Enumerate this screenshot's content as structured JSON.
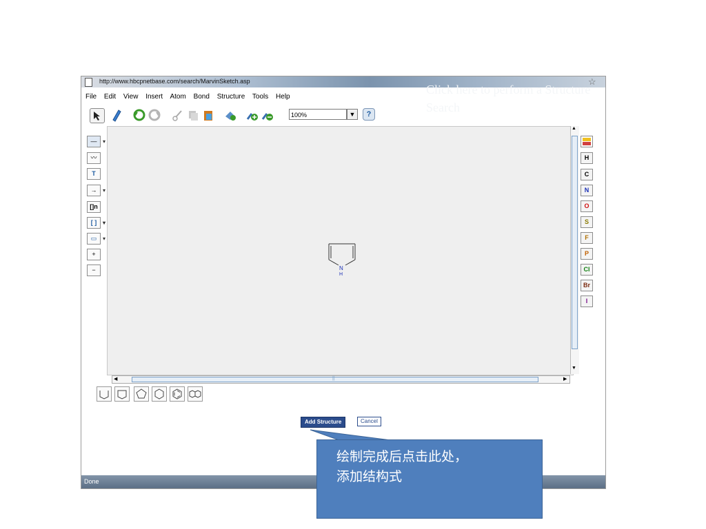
{
  "browser": {
    "url": "http://www.hbcpnetbase.com/search/MarvinSketch.asp",
    "status": "Done"
  },
  "overlay_title": "Click here to perform a Structure Search",
  "menu": [
    "File",
    "Edit",
    "View",
    "Insert",
    "Atom",
    "Bond",
    "Structure",
    "Tools",
    "Help"
  ],
  "toolbar": {
    "zoom": "100%",
    "help_label": "?"
  },
  "left_tools": [
    {
      "label": "—",
      "icon": "single-bond-icon"
    },
    {
      "label": "〰",
      "icon": "chain-icon"
    },
    {
      "label": "T",
      "icon": "text-icon"
    },
    {
      "label": "→",
      "icon": "reaction-arrow-icon"
    },
    {
      "label": "[]n",
      "icon": "polymer-bracket-icon"
    },
    {
      "label": "[ ]",
      "icon": "bracket-icon"
    },
    {
      "label": "▭",
      "icon": "rectangle-icon"
    },
    {
      "label": "+",
      "icon": "plus-charge-icon"
    },
    {
      "label": "−",
      "icon": "minus-charge-icon"
    }
  ],
  "elements": [
    {
      "label": "H",
      "color": "#000000"
    },
    {
      "label": "C",
      "color": "#000000"
    },
    {
      "label": "N",
      "color": "#1a2fb5"
    },
    {
      "label": "O",
      "color": "#d01010"
    },
    {
      "label": "S",
      "color": "#8a7a00"
    },
    {
      "label": "F",
      "color": "#b07000"
    },
    {
      "label": "P",
      "color": "#c06000"
    },
    {
      "label": "Cl",
      "color": "#108010"
    },
    {
      "label": "Br",
      "color": "#7a2a10"
    },
    {
      "label": "I",
      "color": "#7a108a"
    }
  ],
  "molecule": {
    "atom_n": "N",
    "atom_h": "H"
  },
  "buttons": {
    "add": "Add Structure",
    "cancel": "Cancel"
  },
  "callout": "绘制完成后点击此处，\n添加结构式",
  "hscroll_marker": "||"
}
